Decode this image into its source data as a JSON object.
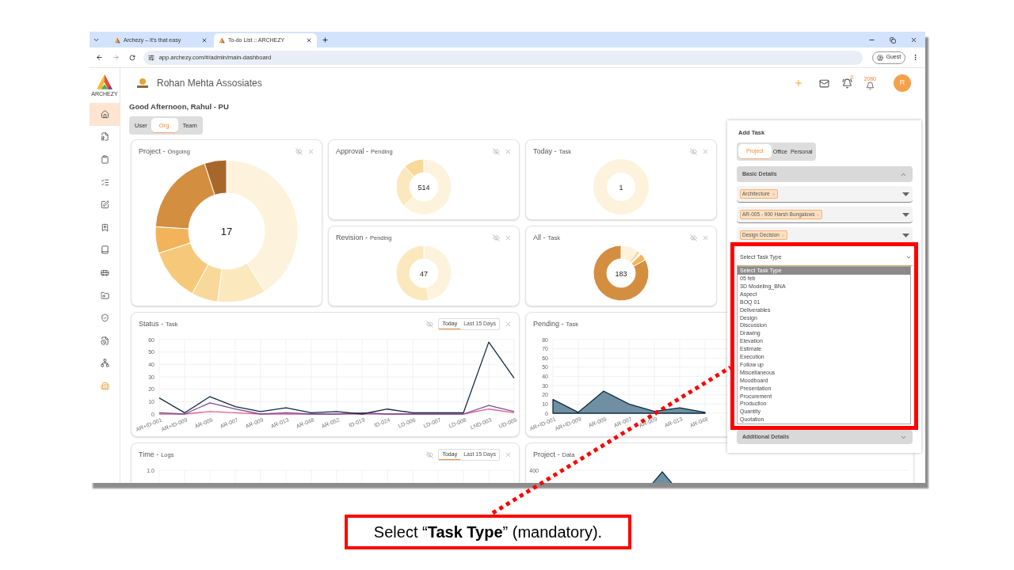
{
  "browser": {
    "tabs": [
      {
        "title": "Archezy – It's that easy",
        "selected": false
      },
      {
        "title": "To-do List :: ARCHEZY",
        "selected": true
      }
    ],
    "url": "app.archezy.com/#/admin/main-dashboard",
    "profile": "Guest"
  },
  "sidebar": {
    "logo_text": "ARCHEZY",
    "items": [
      {
        "selected": true
      },
      {
        "selected": false
      },
      {
        "selected": false
      },
      {
        "selected": false
      },
      {
        "selected": false
      },
      {
        "selected": false
      },
      {
        "selected": false
      },
      {
        "selected": false
      },
      {
        "selected": false
      },
      {
        "selected": false
      },
      {
        "selected": false
      },
      {
        "selected": false
      },
      {
        "selected": false
      }
    ]
  },
  "header": {
    "company": "Rohan Mehta Assosiates",
    "notification_count": "0",
    "points": "2080",
    "avatar": "R"
  },
  "greeting": "Good Afternoon, Rahul - PU",
  "scope_tabs": [
    {
      "label": "User",
      "selected": false
    },
    {
      "label": "Org.",
      "selected": true
    },
    {
      "label": "Team",
      "selected": false
    }
  ],
  "donut_cards": [
    {
      "title": "Project -",
      "subtitle": "Ongoing",
      "total": "17"
    },
    {
      "title": "Approval -",
      "subtitle": "Pending",
      "total": "514"
    },
    {
      "title": "Today -",
      "subtitle": "Task",
      "total": "1"
    },
    {
      "title": "Revision -",
      "subtitle": "Pending",
      "total": "47"
    },
    {
      "title": "All -",
      "subtitle": "Task",
      "total": "183"
    }
  ],
  "line_cards": [
    {
      "title": "Status -",
      "subtitle": "Task",
      "ranges": [
        {
          "label": "Today",
          "selected": true
        },
        {
          "label": "Last 15 Days",
          "selected": false
        }
      ],
      "chart_data": {
        "type": "line",
        "categories": [
          "AR+ID-001",
          "AR+ID-009",
          "AR-005",
          "AR-007",
          "AR-009",
          "AR-013",
          "AR-048",
          "AR-052",
          "ID-019",
          "ID-024",
          "LD-006",
          "LD-007",
          "LD-008",
          "LND-003",
          "UD-005"
        ],
        "ylim": [
          0,
          60
        ],
        "grid": true,
        "yticks": [
          0,
          10,
          20,
          30,
          40,
          50,
          60
        ],
        "series": [
          {
            "color": "#e0608e",
            "values": [
              0,
              0,
              2,
              1,
              0,
              0,
              0,
              0,
              0,
              0,
              0,
              0,
              0,
              4,
              1
            ]
          },
          {
            "color": "#7b4a9c",
            "values": [
              1,
              0,
              9,
              4,
              0,
              1,
              0,
              0,
              1,
              0,
              0,
              0,
              0,
              7,
              2
            ]
          },
          {
            "color": "#0d2c40",
            "values": [
              13,
              1,
              14,
              6,
              2,
              5,
              1,
              2,
              0,
              4,
              1,
              1,
              1,
              58,
              29
            ]
          }
        ]
      }
    },
    {
      "title": "Pending -",
      "subtitle": "Task",
      "chart_data": {
        "type": "area",
        "categories": [
          "AR+ID-001",
          "AR+ID-009",
          "AR-005",
          "AR-007",
          "AR-009",
          "AR-013",
          "AR-048"
        ],
        "ylim": [
          0,
          80
        ],
        "grid": true,
        "yticks": [
          0,
          10,
          20,
          30,
          40,
          50,
          60,
          70,
          80
        ],
        "series": [
          {
            "color": "#0d2c40",
            "values": [
              15,
              1,
              24,
              10,
              2,
              6,
              1
            ]
          }
        ]
      }
    }
  ],
  "bottom_cards": [
    {
      "title": "Time -",
      "subtitle": "Logs",
      "ranges": [
        {
          "label": "Today",
          "selected": true
        },
        {
          "label": "Last 15 Days",
          "selected": false
        }
      ],
      "y_ticks": [
        "1.0"
      ]
    },
    {
      "title": "Project -",
      "subtitle": "Data",
      "y_ticks": [
        "400"
      ]
    }
  ],
  "add_task": {
    "title": "Add Task",
    "tabs": [
      {
        "label": "Project",
        "selected": true
      },
      {
        "label": "Office",
        "selected": false
      },
      {
        "label": "Personal",
        "selected": false
      }
    ],
    "basic_details": {
      "title": "Basic Details",
      "expanded": true,
      "fields": [
        {
          "chip": "Architecture"
        },
        {
          "chip": "AR-005 - 900 Harsh Bungalows"
        },
        {
          "chip": "Design Decision"
        }
      ]
    },
    "task_type": {
      "value": "Select Task Type",
      "options": [
        {
          "label": "Select Task Type",
          "selected": true
        },
        {
          "label": "05 feb",
          "selected": false
        },
        {
          "label": "3D Modeling_BNA",
          "selected": false
        },
        {
          "label": "Aspect",
          "selected": false
        },
        {
          "label": "BOQ 01",
          "selected": false
        },
        {
          "label": "Deliverables",
          "selected": false
        },
        {
          "label": "Design",
          "selected": false
        },
        {
          "label": "Discussion",
          "selected": false
        },
        {
          "label": "Drawing",
          "selected": false
        },
        {
          "label": "Elevation",
          "selected": false
        },
        {
          "label": "Estimate",
          "selected": false
        },
        {
          "label": "Execution",
          "selected": false
        },
        {
          "label": "Follow up",
          "selected": false
        },
        {
          "label": "Miscellaneous",
          "selected": false
        },
        {
          "label": "Moodboard",
          "selected": false
        },
        {
          "label": "Presentation",
          "selected": false
        },
        {
          "label": "Procurement",
          "selected": false
        },
        {
          "label": "Production",
          "selected": false
        },
        {
          "label": "Quantity",
          "selected": false
        },
        {
          "label": "Quotation",
          "selected": false
        }
      ]
    },
    "additional_details": {
      "title": "Additional Details",
      "expanded": false
    }
  },
  "annotation": {
    "text": "Select “**Task Type**” (mandatory)."
  }
}
